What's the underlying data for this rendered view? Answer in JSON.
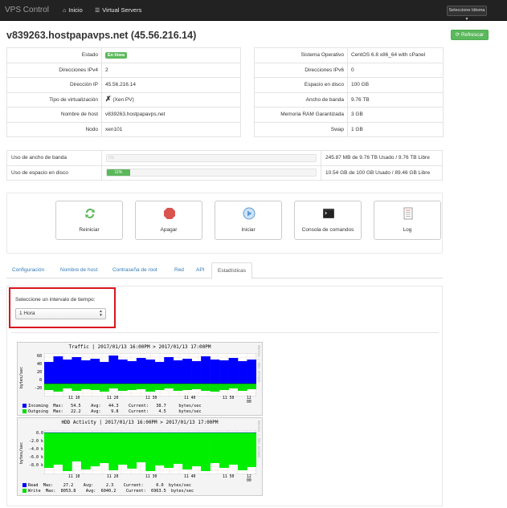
{
  "nav": {
    "brand": "VPS Control",
    "home": "Inicio",
    "servers": "Virtual Servers",
    "language": "Seleccione Idioma"
  },
  "page": {
    "title": "v839263.hostpapavps.net (45.56.216.14)",
    "refresh": "Refrescar"
  },
  "info_left": [
    {
      "label": "Estado",
      "value": "En línea",
      "badge": true
    },
    {
      "label": "Direcciones IPv4",
      "value": "2"
    },
    {
      "label": "Dirección IP",
      "value": "45.56.216.14"
    },
    {
      "label": "Tipo de virtualización",
      "value": "(Xen PV)"
    },
    {
      "label": "Nombre de host",
      "value": "v839263.hostpapavps.net"
    },
    {
      "label": "Nodo",
      "value": "xen101"
    }
  ],
  "info_right": [
    {
      "label": "Sistema Operativo",
      "value": "CentOS 6.8 x86_64 with cPanel"
    },
    {
      "label": "Direcciones IPv6",
      "value": "0"
    },
    {
      "label": "Espacio en disco",
      "value": "100 GB"
    },
    {
      "label": "Ancho de banda",
      "value": "9.76 TB"
    },
    {
      "label": "Memoria RAM Garantizada",
      "value": "3 GB"
    },
    {
      "label": "Swap",
      "value": "1 GB"
    }
  ],
  "usage": [
    {
      "label": "Uso de ancho de banda",
      "percent": 0,
      "bar_text": "0%",
      "detail": "245.87 MB de 9.76 TB Usado / 9.76 TB Libre"
    },
    {
      "label": "Uso de espacio en disco",
      "percent": 11,
      "bar_text": "11%",
      "detail": "10.54 GB de 100 GB Usado / 89.46 GB Libre"
    }
  ],
  "actions": [
    {
      "label": "Reiniciar",
      "icon": "refresh-icon",
      "color": "#5cb85c"
    },
    {
      "label": "Apagar",
      "icon": "stop-icon",
      "color": "#d9534f"
    },
    {
      "label": "Iniciar",
      "icon": "play-icon",
      "color": "#5b9bd5"
    },
    {
      "label": "Consola de comandos",
      "icon": "terminal-icon",
      "color": "#444444"
    },
    {
      "label": "Log",
      "icon": "log-icon",
      "color": "#888888"
    }
  ],
  "tabs": [
    "Configuración",
    "Nombre de host",
    "Contraseña de root",
    "Red",
    "API",
    "Estadísticas"
  ],
  "active_tab": "Estadísticas",
  "stats": {
    "interval_label": "Seleccione un intervalo de tiempo:",
    "interval_value": "1 Hora"
  },
  "graph_side_text": "RRDTOOL / TOBI OETIKER",
  "traffic_graph": {
    "title": "Traffic | 2017/01/13 16:00PM > 2017/01/13 17:00PM",
    "ylabel": "bytes/sec",
    "yticks": [
      "60",
      "40",
      "20",
      "0",
      "-20"
    ],
    "xticks": [
      "11 10",
      "11 20",
      "11 30",
      "11 40",
      "11 50",
      "12 00"
    ],
    "legend": [
      {
        "name": "Incoming",
        "text": "Max:   54.5    Avg:   44.3    Current:   38.7     bytes/sec",
        "color": "#0000ff"
      },
      {
        "name": "Outgoing",
        "text": "Max:   22.2    Avg:    9.8    Current:    4.5     bytes/sec",
        "color": "#00dd00"
      }
    ]
  },
  "hdd_graph": {
    "title": "HDD Activity | 2017/01/13 16:00PM > 2017/01/13 17:00PM",
    "ylabel": "bytes/sec",
    "yticks": [
      "0.0",
      "-2.0 k",
      "-4.0 k",
      "-6.0 k",
      "-8.0 k"
    ],
    "xticks": [
      "11 10",
      "11 20",
      "11 30",
      "11 40",
      "11 50",
      "12 00"
    ],
    "legend": [
      {
        "name": "Read",
        "text": "Max:    27.2    Avg:     2.3    Current:     0.0  bytes/sec",
        "color": "#0000ff"
      },
      {
        "name": "Write",
        "text": "Max:  8053.8    Avg:  6040.2    Current:  6963.5  bytes/sec",
        "color": "#00dd00"
      }
    ]
  },
  "colors": {
    "navbar": "#222222",
    "success": "#5cb85c",
    "link": "#337ab7",
    "highlight": "#d9141d"
  }
}
